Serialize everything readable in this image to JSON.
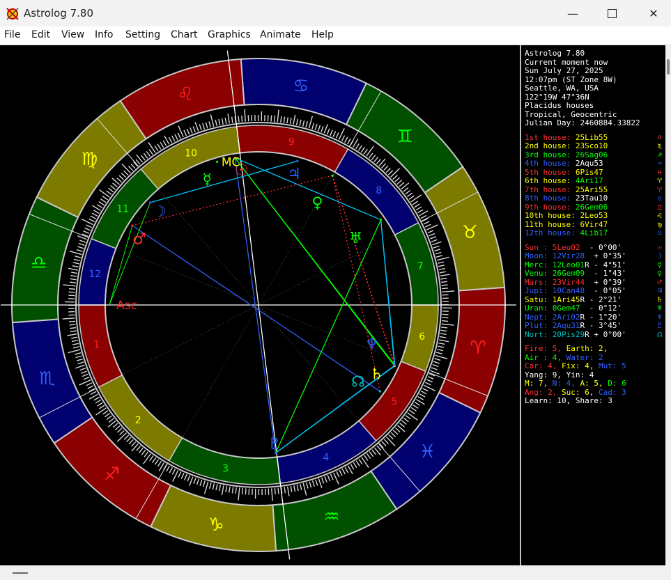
{
  "window": {
    "title": "Astrolog 7.80",
    "icon": "astrolog-app-icon",
    "controls": [
      "minimize-icon",
      "maximize-icon",
      "close-icon"
    ]
  },
  "menu": [
    "File",
    "Edit",
    "View",
    "Info",
    "Setting",
    "Chart",
    "Graphics",
    "Animate",
    "Help"
  ],
  "info_header": [
    "Astrolog 7.80",
    "Current moment now",
    "Sun July 27, 2025",
    "12:07pm (ST Zone 8W)",
    "Seattle, WA, USA",
    "122°19W 47°36N",
    "Placidus houses",
    "Tropical, Geocentric",
    "Julian Day: 2460884.33822"
  ],
  "houses": [
    {
      "label": "1st house:",
      "value": "25Lib55",
      "glyph": "♎",
      "color": "#ff3030"
    },
    {
      "label": "2nd house:",
      "value": "23Sco10",
      "glyph": "♏",
      "color": "#ffff00"
    },
    {
      "label": "3rd house:",
      "value": "26Sag06",
      "glyph": "♐",
      "color": "#00ff00"
    },
    {
      "label": "4th house:",
      "value": "2Aqu53",
      "glyph": "♒",
      "color": "#3060ff"
    },
    {
      "label": "5th house:",
      "value": "6Pis47",
      "glyph": "♓",
      "color": "#ff3030"
    },
    {
      "label": "6th house:",
      "value": "4Ari17",
      "glyph": "♈",
      "color": "#ffff00"
    },
    {
      "label": "7th house:",
      "value": "25Ari55",
      "glyph": "♈",
      "color": "#ff3030"
    },
    {
      "label": "8th house:",
      "value": "23Tau10",
      "glyph": "♉",
      "color": "#3060ff"
    },
    {
      "label": "9th house:",
      "value": "26Gem06",
      "glyph": "♊",
      "color": "#ff3030"
    },
    {
      "label": "10th house:",
      "value": "2Leo53",
      "glyph": "♌",
      "color": "#ffff00"
    },
    {
      "label": "11th house:",
      "value": "6Vir47",
      "glyph": "♍",
      "color": "#ffff00"
    },
    {
      "label": "12th house:",
      "value": "4Lib17",
      "glyph": "♎",
      "color": "#3060ff"
    }
  ],
  "planets": [
    {
      "label": "Sun :",
      "pos": "5Leo02",
      "retro": " ",
      "decl": "- 0°00'",
      "glyph": "☉",
      "color": "#ff3030"
    },
    {
      "label": "Moon:",
      "pos": "12Vir28",
      "retro": " ",
      "decl": "+ 0°35'",
      "glyph": "☽",
      "color": "#3060ff"
    },
    {
      "label": "Merc:",
      "pos": "12Leo01",
      "retro": "R",
      "decl": "- 4°51'",
      "glyph": "☿",
      "color": "#00ff00"
    },
    {
      "label": "Venu:",
      "pos": "26Gem09",
      "retro": " ",
      "decl": "- 1°43'",
      "glyph": "♀",
      "color": "#00ff00"
    },
    {
      "label": "Mars:",
      "pos": "23Vir44",
      "retro": " ",
      "decl": "+ 0°39'",
      "glyph": "♂",
      "color": "#ff3030"
    },
    {
      "label": "Jupi:",
      "pos": "10Can48",
      "retro": " ",
      "decl": "- 0°05'",
      "glyph": "♃",
      "color": "#3060ff"
    },
    {
      "label": "Satu:",
      "pos": "1Ari45",
      "retro": "R",
      "decl": "- 2°21'",
      "glyph": "♄",
      "color": "#ffff00"
    },
    {
      "label": "Uran:",
      "pos": "0Gem47",
      "retro": " ",
      "decl": "- 0°12'",
      "glyph": "♅",
      "color": "#00ff00"
    },
    {
      "label": "Nept:",
      "pos": "2Ari02",
      "retro": "R",
      "decl": "- 1°20'",
      "glyph": "♆",
      "color": "#3060ff"
    },
    {
      "label": "Plut:",
      "pos": "2Aqu31",
      "retro": "R",
      "decl": "- 3°45'",
      "glyph": "♇",
      "color": "#3060ff"
    },
    {
      "label": "Nort:",
      "pos": "20Pis29",
      "retro": "R",
      "decl": "+ 0°00'",
      "glyph": "☊",
      "color": "#00c0c0"
    }
  ],
  "elements": {
    "fire": "Fire: 5,",
    "earth": "Earth: 2,",
    "air": "Air : 4,",
    "water": "Water: 2",
    "car": "Car: 4,",
    "fix": "Fix: 4,",
    "mut": "Mut: 5",
    "yang": "Yang: 9, Yin: 4",
    "m": "M: 7,",
    "n": "N: 4,",
    "a": "A: 5,",
    "d": "D: 6",
    "ang": "Ang: 2,",
    "suc": "Suc: 6,",
    "cad": "Cad: 3",
    "learn": "Learn: 10, Share: 3"
  },
  "colors": {
    "red": "#8b0000",
    "yellow": "#7d7a00",
    "green": "#005000",
    "blue": "#00006e"
  },
  "zodiac_signs": [
    {
      "name": "aries",
      "glyph": "♈"
    },
    {
      "name": "taurus",
      "glyph": "♉"
    },
    {
      "name": "gemini",
      "glyph": "♊"
    },
    {
      "name": "cancer",
      "glyph": "♋"
    },
    {
      "name": "leo",
      "glyph": "♌"
    },
    {
      "name": "virgo",
      "glyph": "♍"
    },
    {
      "name": "libra",
      "glyph": "♎"
    },
    {
      "name": "scorpio",
      "glyph": "♏"
    },
    {
      "name": "sagittarius",
      "glyph": "♐"
    },
    {
      "name": "capricorn",
      "glyph": "♑"
    },
    {
      "name": "aquarius",
      "glyph": "♒"
    },
    {
      "name": "pisces",
      "glyph": "♓"
    }
  ],
  "house_numbers": [
    "1",
    "2",
    "3",
    "4",
    "5",
    "6",
    "7",
    "8",
    "9",
    "10",
    "11",
    "12"
  ],
  "angle_labels": {
    "asc": "Asc",
    "mc": "MC"
  }
}
